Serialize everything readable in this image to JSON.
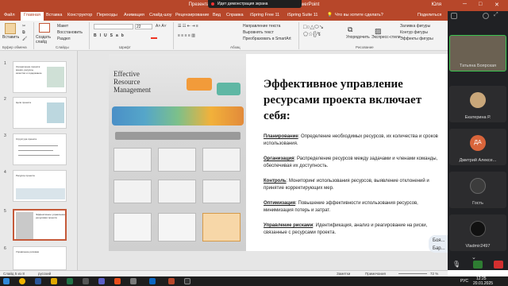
{
  "window": {
    "title": "Презентация 3 - Управление ... и ограничение - PowerPoint",
    "user": "Юля",
    "minimize": "─",
    "maximize": "□",
    "close": "✕"
  },
  "banner": {
    "text": "Идет демонстрация экрана"
  },
  "ribbon_tabs": [
    "Файл",
    "Главная",
    "Вставка",
    "Конструктор",
    "Переходы",
    "Анимация",
    "Слайд-шоу",
    "Рецензирование",
    "Вид",
    "Справка",
    "iSpring Free 11",
    "iSpring Suite 11"
  ],
  "active_tab": "Главная",
  "search": "Что вы хотите сделать?",
  "share": "Поделиться",
  "ribbon": {
    "paste": "Вставить",
    "clipboard_group": "Буфер обмена",
    "new_slide": "Создать слайд",
    "layout": "Макет",
    "reset": "Восстановить",
    "section": "Раздел",
    "slides_group": "Слайды",
    "font_group": "Шрифт",
    "font_size": "22",
    "paragraph_group": "Абзац",
    "text_direction": "Направление текста",
    "align_text": "Выровнять текст",
    "smartart": "Преобразовать в SmartArt",
    "drawing_group": "Рисование",
    "arrange": "Упорядочить",
    "express_styles": "Экспресс-стили",
    "shape_fill": "Заливка фигуры",
    "shape_outline": "Контур фигуры",
    "shape_effects": "Эффекты фигуры",
    "find": "Найти",
    "replace": "Заменить",
    "select": "Выделить",
    "editing_group": "Редактирование"
  },
  "thumbnails": [
    {
      "num": "1",
      "text": "Ограничение проекта: время, ресурсы, качество и содержание"
    },
    {
      "num": "2",
      "text": "Цели проекта"
    },
    {
      "num": "3",
      "text": "Структура проекта"
    },
    {
      "num": "4",
      "text": "Ресурсы проекта"
    },
    {
      "num": "5",
      "text": "Эффективное управление ресурсами проекта"
    },
    {
      "num": "6",
      "text": "Управление рисками"
    }
  ],
  "slide": {
    "infographic_title": "Effective Resource Management",
    "title": "Эффективное управление ресурсами проекта включает себя:",
    "items": [
      {
        "term": "Планирование",
        "text": ": Определение необходимых ресурсов, их количества и сроков использования."
      },
      {
        "term": "Организация",
        "text": ": Распределение ресурсов между задачами и членами команды, обеспечивая их доступность."
      },
      {
        "term": "Контроль",
        "text": ": Мониторинг использования ресурсов, выявление отклонений и принятие корректирующих мер."
      },
      {
        "term": "Оптимизация",
        "text": ": Повышение эффективности использования ресурсов, минимизация потерь и затрат."
      },
      {
        "term": "Управление рисками",
        "text": ": Идентификация, анализ и реагирование на риски, связанные с ресурсами проекта."
      }
    ],
    "overlay_name": "Боя... Бар..."
  },
  "participants": [
    {
      "name": "Татьяна Боярская",
      "color": "#7a6a52"
    },
    {
      "name": "Екатерина Р.",
      "color": "#c9a77a"
    },
    {
      "name": "Дмитрий Алексе...",
      "initials": "ДА",
      "color": "#d9653b"
    },
    {
      "name": "Гость",
      "color": "#3c3c3c"
    },
    {
      "name": "Vladmir2497",
      "color": "#1a1a1a"
    }
  ],
  "status": {
    "slide_info": "Слайд 5 из 8",
    "language": "русский",
    "notes": "Заметки",
    "comments": "Примечания",
    "zoom": "72 %"
  },
  "taskbar": {
    "language": "РУС",
    "time": "12:25",
    "date": "20.01.2025"
  }
}
